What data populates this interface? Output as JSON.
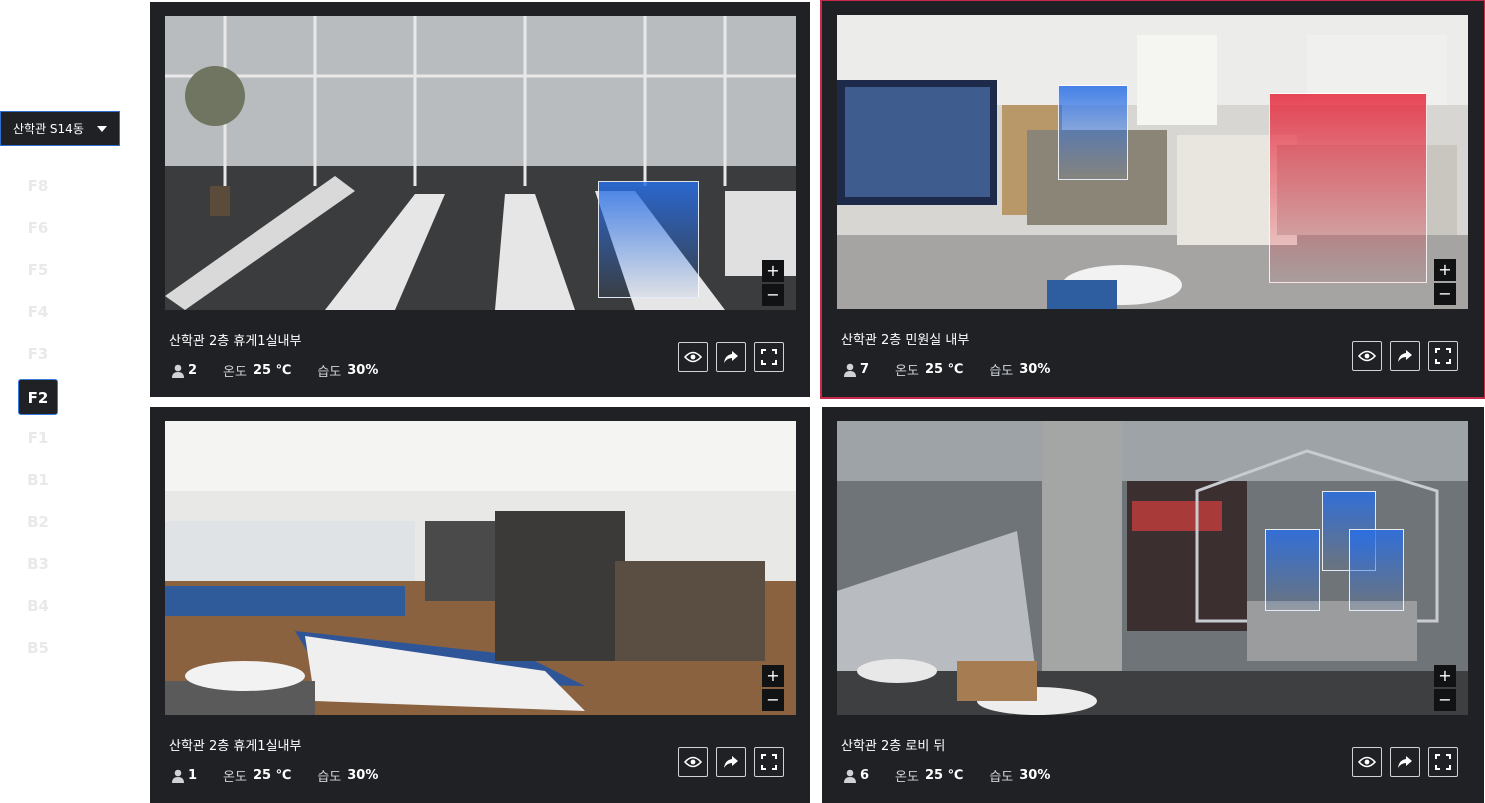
{
  "building": {
    "selected": "산학관 S14동"
  },
  "floors": {
    "items": [
      "F8",
      "F6",
      "F5",
      "F4",
      "F3",
      "F2",
      "F1",
      "B1",
      "B2",
      "B3",
      "B4",
      "B5"
    ],
    "active": "F2"
  },
  "labels": {
    "temp": "온도",
    "humidity": "습도"
  },
  "cameras": [
    {
      "title": "산학관 2층 휴게1실내부",
      "people": "2",
      "temp": "25 ℃",
      "humidity": "30%"
    },
    {
      "title": "산학관 2층 민원실 내부",
      "people": "7",
      "temp": "25 ℃",
      "humidity": "30%"
    },
    {
      "title": "산학관 2층 휴게1실내부",
      "people": "1",
      "temp": "25 ℃",
      "humidity": "30%"
    },
    {
      "title": "산학관 2층 로비 뒤",
      "people": "6",
      "temp": "25 ℃",
      "humidity": "30%"
    }
  ],
  "zoom": {
    "in": "+",
    "out": "−"
  },
  "colors": {
    "panel": "#1f2125",
    "selected_outline": "#c8284a",
    "detection_blue": "#286ee6",
    "detection_red": "#e6283c"
  }
}
